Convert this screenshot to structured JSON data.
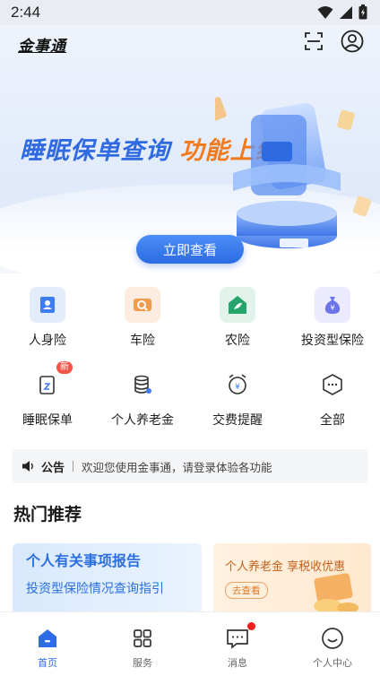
{
  "status": {
    "time": "2:44"
  },
  "header": {
    "app_name": "金事通"
  },
  "banner": {
    "title_part1": "睡眠保单查询",
    "title_part2": "功能上线!",
    "button_label": "立即查看",
    "brand_color": "#2f6ae0",
    "accent_color": "#f07a1c"
  },
  "services": [
    {
      "label": "人身险",
      "icon": "person-card-icon"
    },
    {
      "label": "车险",
      "icon": "car-icon"
    },
    {
      "label": "农险",
      "icon": "leaf-house-icon"
    },
    {
      "label": "投资型保险",
      "icon": "money-bag-icon"
    },
    {
      "label": "睡眠保单",
      "icon": "sleep-document-icon",
      "badge": "新"
    },
    {
      "label": "个人养老金",
      "icon": "coin-stack-icon"
    },
    {
      "label": "交费提醒",
      "icon": "alarm-clock-icon"
    },
    {
      "label": "全部",
      "icon": "more-hexagon-icon"
    }
  ],
  "notice": {
    "label": "公告",
    "text": "欢迎您使用金事通，请登录体验各功能"
  },
  "hot": {
    "title": "热门推荐",
    "card1": {
      "title": "个人有关事项报告",
      "subtitle": "投资型保险情况查询指引"
    },
    "card2": {
      "title": "个人养老金 享税收优惠",
      "tag": "去查看"
    }
  },
  "tabs": [
    {
      "label": "首页",
      "active": true
    },
    {
      "label": "服务"
    },
    {
      "label": "消息",
      "dot": true
    },
    {
      "label": "个人中心"
    }
  ]
}
